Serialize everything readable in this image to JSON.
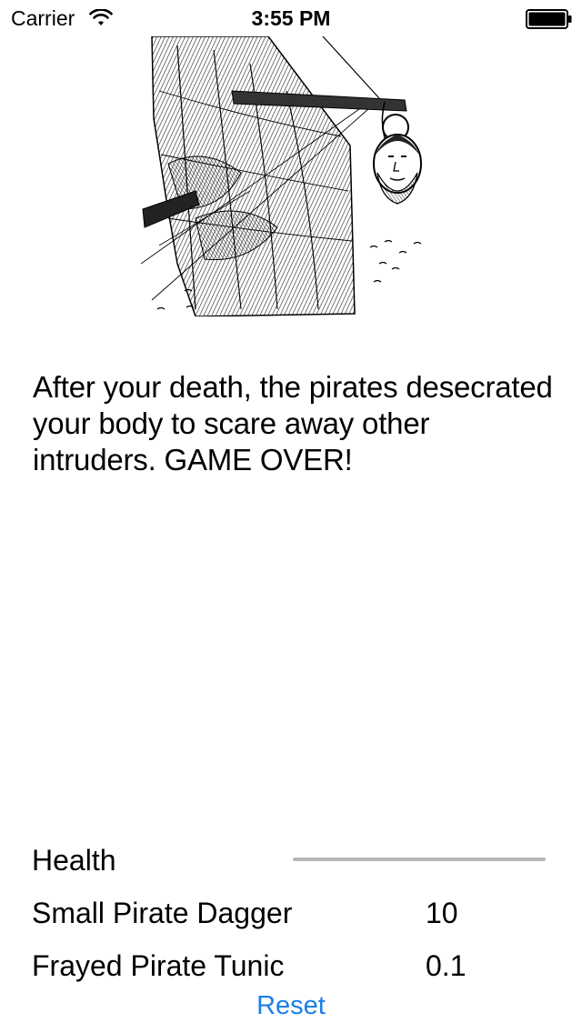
{
  "status_bar": {
    "carrier": "Carrier",
    "time": "3:55 PM",
    "wifi_icon": "wifi-icon",
    "battery_icon": "battery-full-icon",
    "battery_level": 1.0
  },
  "scene": {
    "icon": "pirate-ship-severed-head-illustration"
  },
  "story": {
    "text": "After your death, the pirates desecrated your body to scare away other intruders. GAME OVER!"
  },
  "stats": {
    "health": {
      "label": "Health",
      "progress": 0.0
    },
    "weapon": {
      "name": "Small Pirate Dagger",
      "value": "10"
    },
    "armor": {
      "name": "Frayed Pirate Tunic",
      "value": "0.1"
    }
  },
  "actions": {
    "reset_label": "Reset"
  },
  "colors": {
    "accent": "#1a7fe8",
    "progress_track": "#b7b7b7",
    "text": "#000000",
    "background": "#ffffff"
  }
}
